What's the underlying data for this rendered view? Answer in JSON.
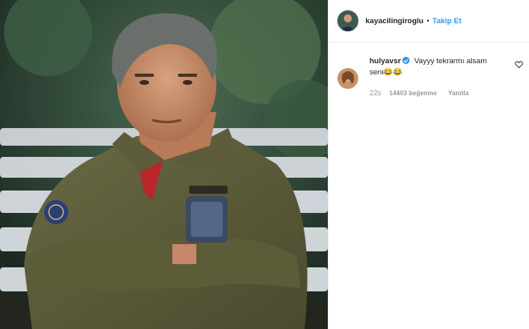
{
  "post": {
    "author": "kayacilingiroglu",
    "separator": "•",
    "follow_label": "Takip Et",
    "image_icon": "portrait-photo"
  },
  "comments": [
    {
      "username": "hulyavsr",
      "verified": true,
      "text": "Vayyy tekrarmı alsam seni😂😂",
      "time": "22s",
      "likes": "14403 beğenme",
      "reply_label": "Yanıtla"
    }
  ],
  "colors": {
    "accent": "#3897f0",
    "text": "#262626",
    "muted": "#999999",
    "border": "#efefef"
  }
}
